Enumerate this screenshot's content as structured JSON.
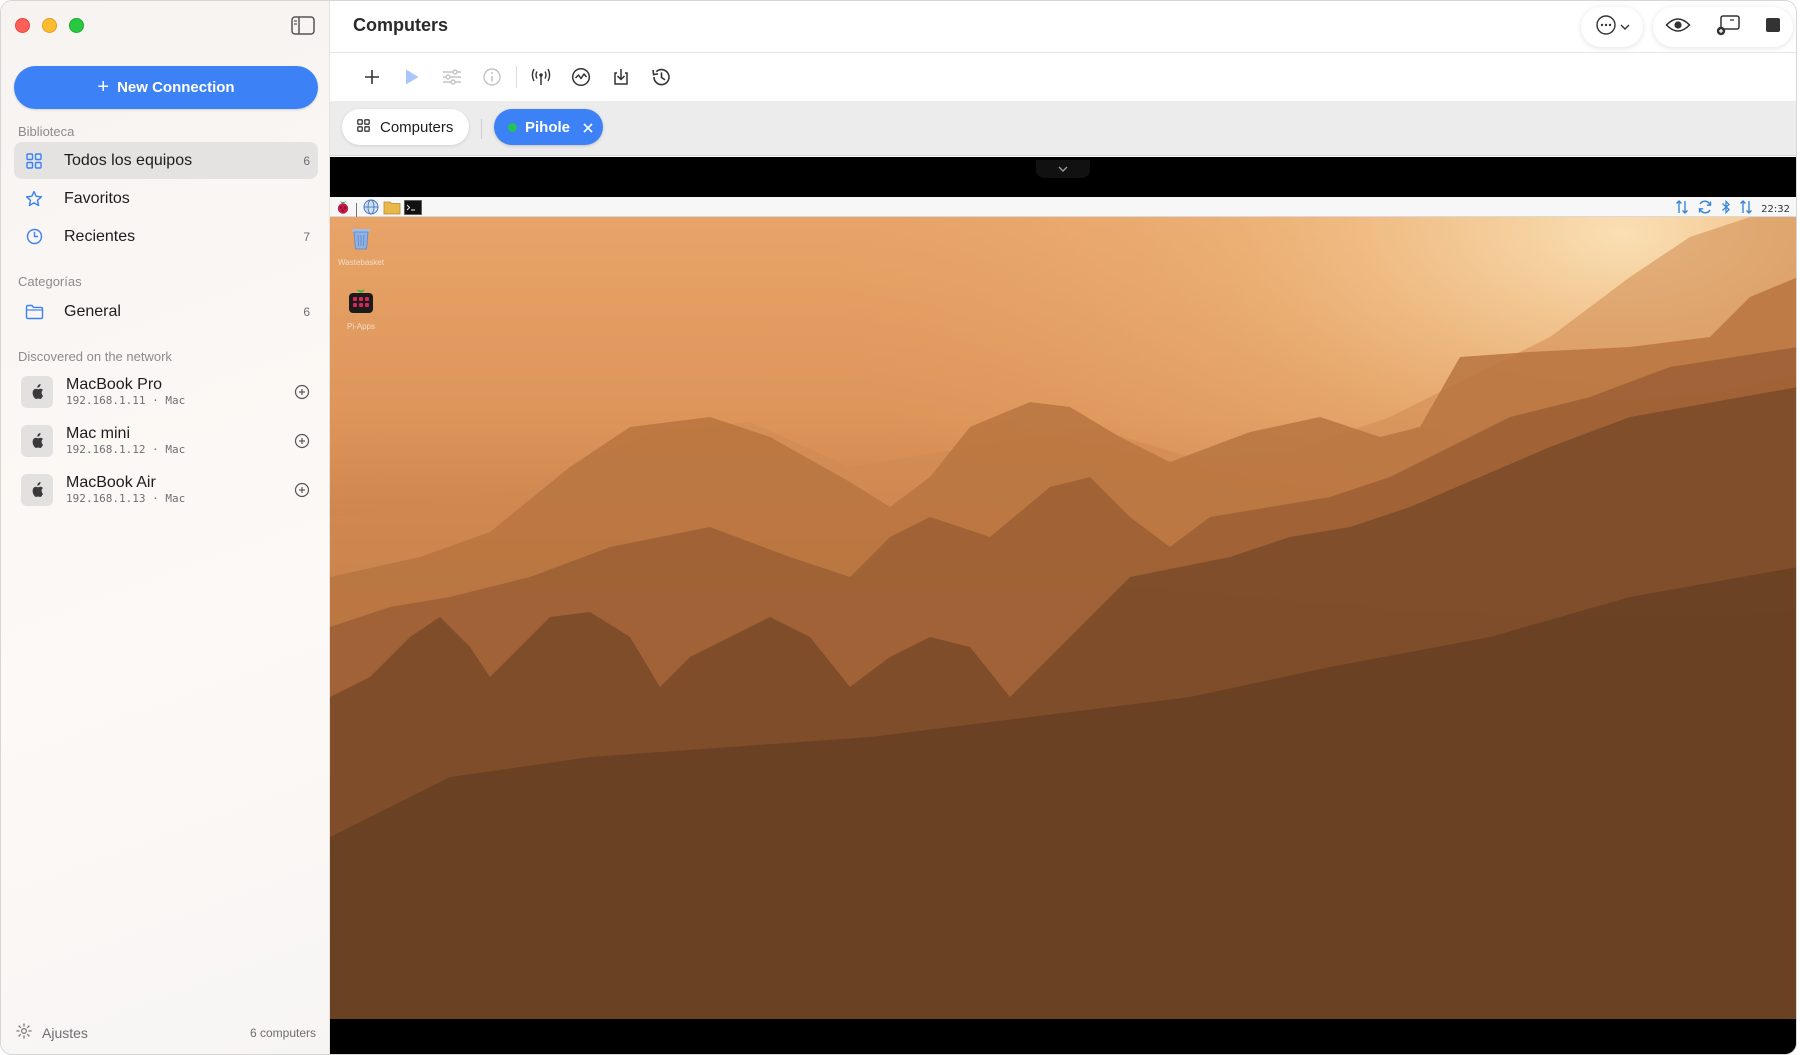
{
  "sidebar": {
    "new_connection_label": "New Connection",
    "library_title": "Biblioteca",
    "library_items": [
      {
        "label": "Todos los equipos",
        "count": "6"
      },
      {
        "label": "Favoritos",
        "count": ""
      },
      {
        "label": "Recientes",
        "count": "7"
      }
    ],
    "categories_title": "Categorías",
    "categories": [
      {
        "label": "General",
        "count": "6"
      }
    ],
    "discovered_title": "Discovered on the network",
    "discovered": [
      {
        "name": "MacBook Pro",
        "sub": "192.168.1.11 · Mac"
      },
      {
        "name": "Mac mini",
        "sub": "192.168.1.12 · Mac"
      },
      {
        "name": "MacBook Air",
        "sub": "192.168.1.13 · Mac"
      }
    ],
    "footer": {
      "settings_label": "Ajustes",
      "count_label": "6 computers"
    }
  },
  "main": {
    "title": "Computers",
    "tabs": [
      {
        "label": "Computers"
      },
      {
        "label": "Pihole",
        "status_color": "#24c25a"
      }
    ]
  },
  "remote": {
    "clock": "22:32",
    "desktop_icons": [
      {
        "label": "Wastebasket"
      },
      {
        "label": "Pi-Apps"
      }
    ]
  },
  "colors": {
    "accent": "#3c82f6",
    "online": "#24c25a"
  }
}
